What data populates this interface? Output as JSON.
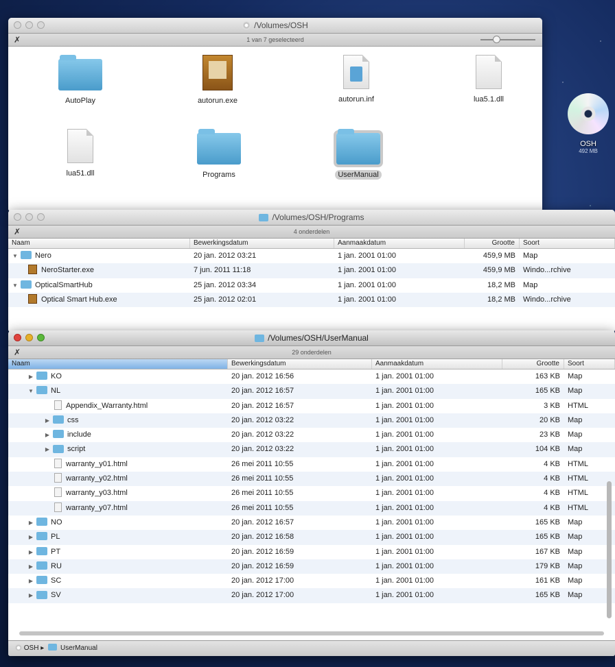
{
  "desktop": {
    "disk_name": "OSH",
    "disk_size": "492 MB"
  },
  "win1": {
    "title": "/Volumes/OSH",
    "status": "1 van 7 geselecteerd",
    "icons": [
      {
        "label": "AutoPlay",
        "kind": "folder",
        "selected": false
      },
      {
        "label": "autorun.exe",
        "kind": "exe",
        "selected": false
      },
      {
        "label": "autorun.inf",
        "kind": "inf",
        "selected": false
      },
      {
        "label": "lua5.1.dll",
        "kind": "doc",
        "selected": false
      },
      {
        "label": "lua51.dll",
        "kind": "doc",
        "selected": false
      },
      {
        "label": "Programs",
        "kind": "folder",
        "selected": false
      },
      {
        "label": "UserManual",
        "kind": "folder",
        "selected": true
      }
    ]
  },
  "win2": {
    "title": "/Volumes/OSH/Programs",
    "status": "4 onderdelen",
    "headers": {
      "name": "Naam",
      "date": "Bewerkingsdatum",
      "created": "Aanmaakdatum",
      "size": "Grootte",
      "kind": "Soort"
    },
    "rows": [
      {
        "name": "Nero",
        "date": "20 jan. 2012 03:21",
        "created": "1 jan. 2001 01:00",
        "size": "459,9 MB",
        "kind": "Map"
      },
      {
        "name": "NeroStarter.exe",
        "date": "7 jun. 2011 11:18",
        "created": "1 jan. 2001 01:00",
        "size": "459,9 MB",
        "kind": "Windo...rchive"
      },
      {
        "name": "OpticalSmartHub",
        "date": "25 jan. 2012 03:34",
        "created": "1 jan. 2001 01:00",
        "size": "18,2 MB",
        "kind": "Map"
      },
      {
        "name": "Optical Smart Hub.exe",
        "date": "25 jan. 2012 02:01",
        "created": "1 jan. 2001 01:00",
        "size": "18,2 MB",
        "kind": "Windo...rchive"
      }
    ]
  },
  "win3": {
    "title": "/Volumes/OSH/UserManual",
    "status": "29 onderdelen",
    "headers": {
      "name": "Naam",
      "date": "Bewerkingsdatum",
      "created": "Aanmaakdatum",
      "size": "Grootte",
      "kind": "Soort"
    },
    "rows": [
      {
        "name": "KO",
        "date": "20 jan. 2012 16:56",
        "created": "1 jan. 2001 01:00",
        "size": "163 KB",
        "kind": "Map"
      },
      {
        "name": "NL",
        "date": "20 jan. 2012 16:57",
        "created": "1 jan. 2001 01:00",
        "size": "165 KB",
        "kind": "Map"
      },
      {
        "name": "Appendix_Warranty.html",
        "date": "20 jan. 2012 16:57",
        "created": "1 jan. 2001 01:00",
        "size": "3 KB",
        "kind": "HTML"
      },
      {
        "name": "css",
        "date": "20 jan. 2012 03:22",
        "created": "1 jan. 2001 01:00",
        "size": "20 KB",
        "kind": "Map"
      },
      {
        "name": "include",
        "date": "20 jan. 2012 03:22",
        "created": "1 jan. 2001 01:00",
        "size": "23 KB",
        "kind": "Map"
      },
      {
        "name": "script",
        "date": "20 jan. 2012 03:22",
        "created": "1 jan. 2001 01:00",
        "size": "104 KB",
        "kind": "Map"
      },
      {
        "name": "warranty_y01.html",
        "date": "26 mei 2011 10:55",
        "created": "1 jan. 2001 01:00",
        "size": "4 KB",
        "kind": "HTML"
      },
      {
        "name": "warranty_y02.html",
        "date": "26 mei 2011 10:55",
        "created": "1 jan. 2001 01:00",
        "size": "4 KB",
        "kind": "HTML"
      },
      {
        "name": "warranty_y03.html",
        "date": "26 mei 2011 10:55",
        "created": "1 jan. 2001 01:00",
        "size": "4 KB",
        "kind": "HTML"
      },
      {
        "name": "warranty_y07.html",
        "date": "26 mei 2011 10:55",
        "created": "1 jan. 2001 01:00",
        "size": "4 KB",
        "kind": "HTML"
      },
      {
        "name": "NO",
        "date": "20 jan. 2012 16:57",
        "created": "1 jan. 2001 01:00",
        "size": "165 KB",
        "kind": "Map"
      },
      {
        "name": "PL",
        "date": "20 jan. 2012 16:58",
        "created": "1 jan. 2001 01:00",
        "size": "165 KB",
        "kind": "Map"
      },
      {
        "name": "PT",
        "date": "20 jan. 2012 16:59",
        "created": "1 jan. 2001 01:00",
        "size": "167 KB",
        "kind": "Map"
      },
      {
        "name": "RU",
        "date": "20 jan. 2012 16:59",
        "created": "1 jan. 2001 01:00",
        "size": "179 KB",
        "kind": "Map"
      },
      {
        "name": "SC",
        "date": "20 jan. 2012 17:00",
        "created": "1 jan. 2001 01:00",
        "size": "161 KB",
        "kind": "Map"
      },
      {
        "name": "SV",
        "date": "20 jan. 2012 17:00",
        "created": "1 jan. 2001 01:00",
        "size": "165 KB",
        "kind": "Map"
      }
    ],
    "path": {
      "disk": "OSH",
      "separator": "▸",
      "folder": "UserManual"
    }
  }
}
